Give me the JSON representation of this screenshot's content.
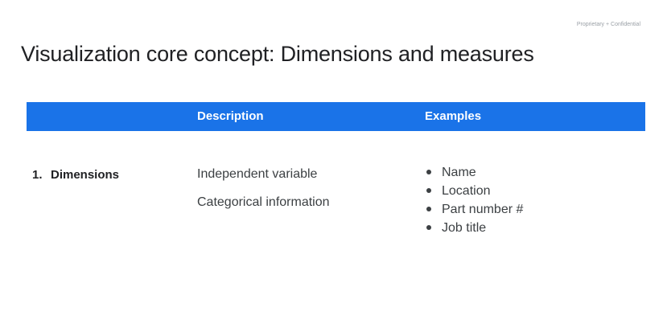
{
  "footer": {
    "confidential": "Proprietary + Confidential"
  },
  "slide": {
    "title": "Visualization core concept: Dimensions and measures"
  },
  "table": {
    "headers": {
      "description": "Description",
      "examples": "Examples"
    },
    "rows": [
      {
        "number": "1.",
        "label": "Dimensions",
        "descriptions": [
          "Independent variable",
          "Categorical information"
        ],
        "examples": [
          "Name",
          "Location",
          "Part number #",
          "Job title"
        ]
      }
    ]
  },
  "colors": {
    "header_background": "#1a73e8",
    "header_text": "#ffffff",
    "title_text": "#202124",
    "body_text": "#3c4043"
  }
}
